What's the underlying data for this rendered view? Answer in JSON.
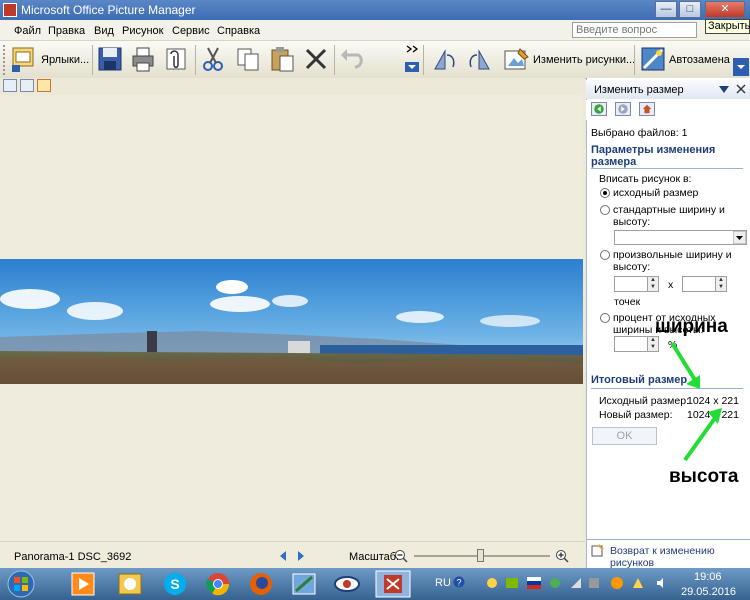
{
  "window": {
    "title": "Microsoft Office Picture Manager"
  },
  "window_controls": {
    "min": "—",
    "max": "□",
    "close": "✕"
  },
  "menu": {
    "items": [
      "Файл",
      "Правка",
      "Вид",
      "Рисунок",
      "Сервис",
      "Справка"
    ]
  },
  "help_box": {
    "placeholder": "Введите вопрос"
  },
  "close_tooltip": "Закрыть",
  "toolbar": {
    "shortcuts_label": "Ярлыки...",
    "edit_pictures_label": "Изменить рисунки...",
    "autocorrect_label": "Автозамена"
  },
  "status": {
    "filename": "Panorama-1 DSC_3692",
    "zoom_label": "Масштаб:"
  },
  "pane": {
    "title": "Изменить размер",
    "files_selected": "Выбрано файлов: 1",
    "section_params": "Параметры изменения размера",
    "fit_label": "Вписать рисунок в:",
    "options": {
      "original": "исходный размер",
      "standard": "стандартные ширину и высоту:",
      "custom": "произвольные ширину и высоту:",
      "percent": "процент от исходных ширины и высоты:"
    },
    "x_label": "х",
    "points_label": "точек",
    "percent_sign": "%",
    "section_total": "Итоговый размер",
    "original_size_label": "Исходный размер:",
    "original_size_value": "1024 х 221",
    "new_size_label": "Новый размер:",
    "new_size_value": "1024 х 221",
    "ok_label": "OK",
    "back_link": "Возврат к изменению рисунков"
  },
  "annotations": {
    "width": "ширина",
    "height": "высота",
    "arrow_color": "#22dd33"
  },
  "taskbar": {
    "lang": "RU",
    "time": "19:06",
    "date": "29.05.2016"
  }
}
